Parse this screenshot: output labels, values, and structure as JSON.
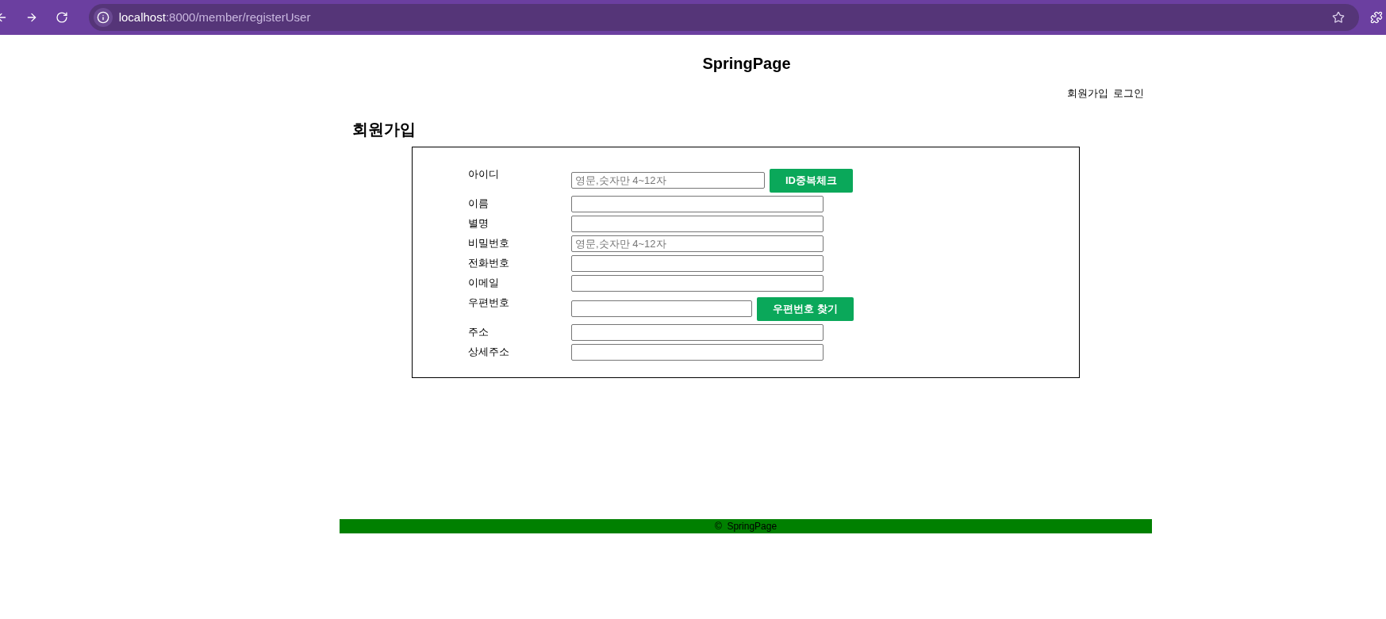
{
  "browser": {
    "url_host": "localhost",
    "url_path": ":8000/member/registerUser"
  },
  "header": {
    "title": "SpringPage",
    "nav": [
      "회원가입",
      "로그인"
    ]
  },
  "page_title": "회원가입",
  "form": {
    "fields": [
      {
        "label": "아이디",
        "placeholder": "영문,숫자만 4~12자",
        "button": "ID중복체크"
      },
      {
        "label": "이름"
      },
      {
        "label": "별명"
      },
      {
        "label": "비밀번호",
        "placeholder": "영문,숫자만 4~12자"
      },
      {
        "label": "전화번호"
      },
      {
        "label": "이메일"
      },
      {
        "label": "우편번호",
        "button": "우편번호 찾기"
      },
      {
        "label": "주소"
      },
      {
        "label": "상세주소"
      }
    ]
  },
  "footer": "©  SpringPage"
}
